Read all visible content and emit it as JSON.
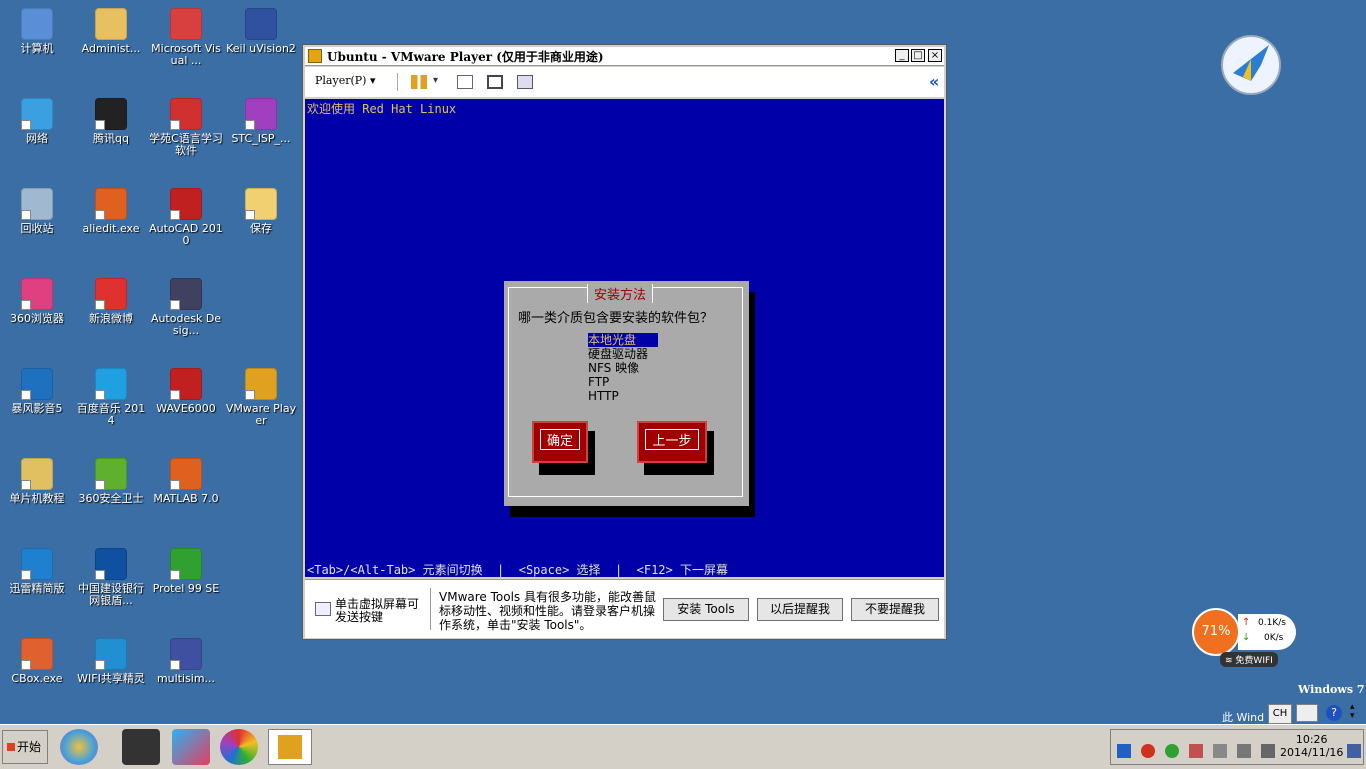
{
  "desktop": {
    "icons": [
      {
        "label": "计算机",
        "color": "#5a8fd8"
      },
      {
        "label": "Administ...",
        "color": "#e8c060"
      },
      {
        "label": "Microsoft Visual ...",
        "color": "#d84040"
      },
      {
        "label": "Keil uVision2",
        "color": "#3050a0"
      },
      {
        "label": "网络",
        "color": "#3aa0e0"
      },
      {
        "label": "腾讯qq",
        "color": "#222222"
      },
      {
        "label": "学苑C语言学习软件",
        "color": "#d03030"
      },
      {
        "label": "STC_ISP_...",
        "color": "#a040c0"
      },
      {
        "label": "回收站",
        "color": "#a0b8d0"
      },
      {
        "label": "aliedit.exe",
        "color": "#e06020"
      },
      {
        "label": "AutoCAD 2010",
        "color": "#c02020"
      },
      {
        "label": "保存",
        "color": "#f0d070"
      },
      {
        "label": "360浏览器",
        "color": "#e04080"
      },
      {
        "label": "新浪微博",
        "color": "#e03030"
      },
      {
        "label": "Autodesk Desig...",
        "color": "#404060"
      },
      {
        "label": "暴风影音5",
        "color": "#2070c0"
      },
      {
        "label": "百度音乐 2014",
        "color": "#20a0e0"
      },
      {
        "label": "WAVE6000",
        "color": "#c02020"
      },
      {
        "label": "VMware Player",
        "color": "#e0a020"
      },
      {
        "label": "单片机教程",
        "color": "#e0c060"
      },
      {
        "label": "360安全卫士",
        "color": "#60b030"
      },
      {
        "label": "MATLAB 7.0",
        "color": "#e06020"
      },
      {
        "label": "迅雷精简版",
        "color": "#2080d0"
      },
      {
        "label": "中国建设银行网银盾...",
        "color": "#1050a0"
      },
      {
        "label": "Protel 99 SE",
        "color": "#30a030"
      },
      {
        "label": "CBox.exe",
        "color": "#e06030"
      },
      {
        "label": "WIFI共享精灵",
        "color": "#2090d0"
      },
      {
        "label": "multisim...",
        "color": "#4050a0"
      }
    ]
  },
  "vmware": {
    "title": "Ubuntu - VMware Player (仅用于非商业用途)",
    "player_menu": "Player(P)",
    "expand_glyph": "«",
    "screen": {
      "welcome": "欢迎使用 Red Hat Linux",
      "dialog_title": "安装方法",
      "question": "哪一类介质包含要安装的软件包？",
      "options": [
        "本地光盘",
        "硬盘驱动器",
        "NFS 映像",
        "FTP",
        "HTTP"
      ],
      "selected_index": 0,
      "ok_label": "确定",
      "back_label": "上一步",
      "status_line": "<Tab>/<Alt-Tab> 元素间切换  |  <Space> 选择  |  <F12> 下一屏幕"
    },
    "bottom": {
      "hint": "单击虚拟屏幕可发送按键",
      "message": "VMware Tools 具有很多功能，能改善鼠标移动性、视频和性能。请登录客户机操作系统，单击\"安装 Tools\"。",
      "install_tools": "安装 Tools",
      "remind_later": "以后提醒我",
      "never_remind": "不要提醒我"
    }
  },
  "overlay": {
    "battery_percent": "71%",
    "upload": "0.1K/s",
    "download": "0K/s",
    "wifi_label": "免费WIFI",
    "windows_label": "Windows 7",
    "windows_sub": "此 Wind",
    "lang": "CH"
  },
  "taskbar": {
    "start": "开始",
    "time": "10:26",
    "date": "2014/11/16"
  },
  "colors": {
    "desktop": "#3a6ea5",
    "vm_screen": "#0000a8",
    "dialog": "#aaaaaa",
    "button_red": "#a00000"
  }
}
